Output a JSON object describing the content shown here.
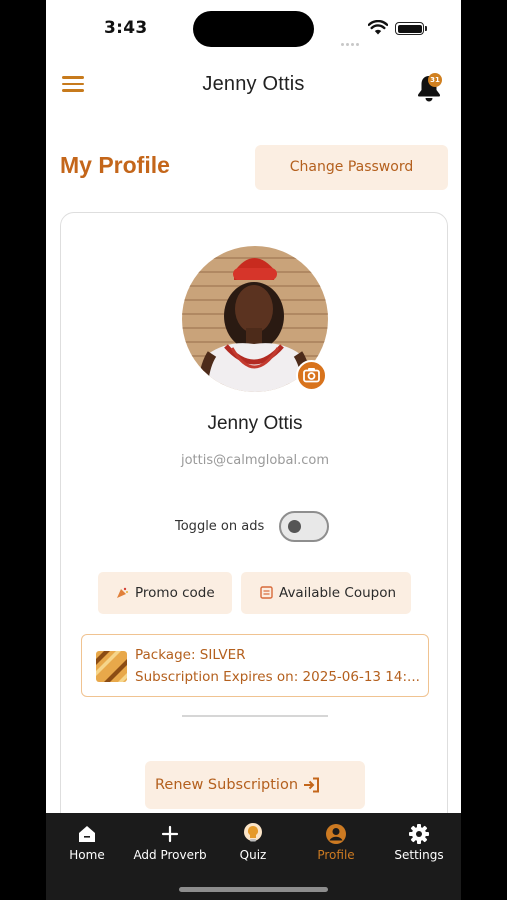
{
  "status_bar": {
    "time": "3:43"
  },
  "header": {
    "title": "Jenny  Ottis",
    "notification_count": "31"
  },
  "page": {
    "title": "My Profile",
    "change_password_label": "Change Password"
  },
  "profile": {
    "name": "Jenny Ottis",
    "email": "jottis@calmglobal.com"
  },
  "ads": {
    "label": "Toggle on ads",
    "enabled": false
  },
  "actions": {
    "promo_label": "Promo code",
    "coupon_label": "Available Coupon"
  },
  "subscription": {
    "package_line": "Package: SILVER",
    "expiry_line": "Subscription Expires on: 2025-06-13 14:..."
  },
  "renew_label": "Renew Subscription",
  "nav": {
    "items": [
      {
        "label": "Home",
        "icon": "home-icon"
      },
      {
        "label": "Add Proverb",
        "icon": "plus-icon"
      },
      {
        "label": "Quiz",
        "icon": "bulb-icon"
      },
      {
        "label": "Profile",
        "icon": "person-icon",
        "active": true
      },
      {
        "label": "Settings",
        "icon": "gear-icon"
      }
    ]
  },
  "colors": {
    "accent": "#c4661a",
    "accent_soft": "#fbeee2",
    "nav_bg": "#1b1b1b"
  }
}
